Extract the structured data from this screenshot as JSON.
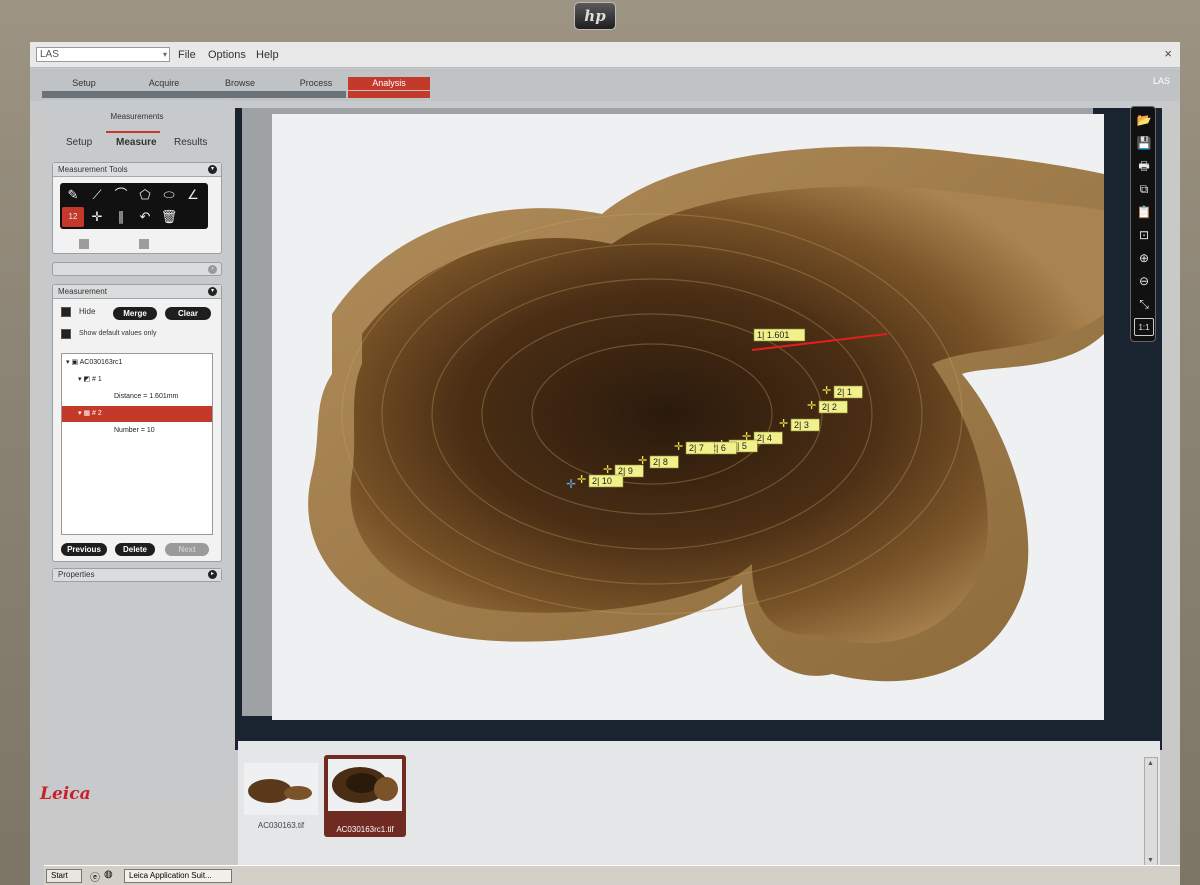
{
  "window": {
    "app_name": "LAS",
    "menu": [
      "File",
      "Options",
      "Help"
    ],
    "brand_right": "LAS",
    "close_glyph": "×"
  },
  "workflow_tabs": [
    {
      "label": "Setup",
      "active": false
    },
    {
      "label": "Acquire",
      "active": false
    },
    {
      "label": "Browse",
      "active": false
    },
    {
      "label": "Process",
      "active": false
    },
    {
      "label": "Analysis",
      "active": true
    }
  ],
  "left_panel": {
    "title": "Measurements",
    "tabs": [
      "Setup",
      "Measure",
      "Results"
    ],
    "active_tab": "Measure",
    "tools_section": {
      "title": "Measurement Tools",
      "tools": [
        "pointer-icon",
        "line-icon",
        "arc-icon",
        "polygon-icon",
        "ellipse-icon",
        "angle-icon",
        "count-icon",
        "crosshair-icon",
        "parallel-icon",
        "undo-icon",
        "delete-icon"
      ],
      "selected_tool": "count-icon"
    },
    "measurement_section": {
      "title": "Measurement",
      "hide_label": "Hide",
      "merge_label": "Merge",
      "clear_label": "Clear",
      "show_defaults_label": "Show default values only",
      "tree": [
        {
          "label": "AC030163rc1",
          "indent": 0,
          "selected": false
        },
        {
          "label": "# 1",
          "indent": 1,
          "selected": false
        },
        {
          "label": "Distance = 1.601mm",
          "indent": 2,
          "selected": false
        },
        {
          "label": "# 2",
          "indent": 1,
          "selected": true
        },
        {
          "label": "Number = 10",
          "indent": 2,
          "selected": false
        }
      ],
      "previous_label": "Previous",
      "delete_label": "Delete",
      "next_label": "Next"
    },
    "properties_section": {
      "title": "Properties"
    },
    "logo_text": "Leica"
  },
  "viewer": {
    "line_label": "1| 1.601",
    "points": [
      "2| 1",
      "2| 2",
      "2| 3",
      "2| 4",
      "2| 5",
      "2| 6",
      "2| 7",
      "2| 8",
      "2| 9",
      "2| 10"
    ],
    "toolbar": [
      "open-icon",
      "save-icon",
      "print-icon",
      "copy-icon",
      "paste-icon",
      "fit-icon",
      "zoom-in-icon",
      "zoom-out-icon",
      "resize-icon",
      "actual-size-icon"
    ],
    "actual_size_label": "1:1"
  },
  "thumbnails": [
    {
      "label": "AC030163.tif",
      "selected": false
    },
    {
      "label": "AC030163rc1.tif",
      "selected": true
    }
  ],
  "taskbar": {
    "start_label": "Start",
    "task_label": "Leica Application Suit..."
  }
}
